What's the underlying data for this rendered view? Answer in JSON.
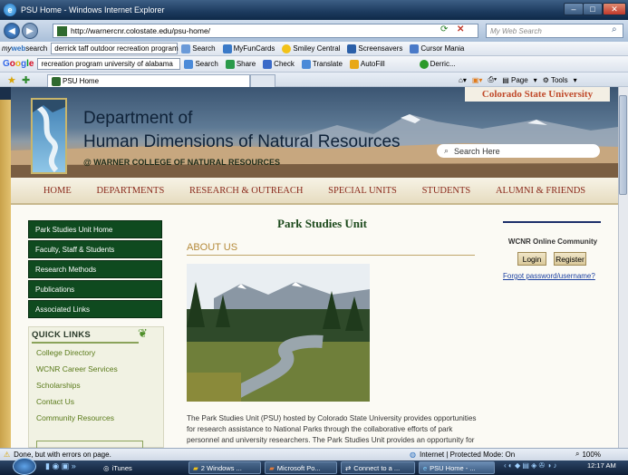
{
  "window": {
    "title": "PSU Home - Windows Internet Explorer"
  },
  "address": {
    "url": "http://warnercnr.colostate.edu/psu-home/",
    "search_placeholder": "My Web Search"
  },
  "mywebsearch": {
    "logo_a": "my",
    "logo_b": "web",
    "logo_c": "search",
    "query": "derrick taff outdoor recreation program",
    "search_label": "Search",
    "items": [
      "MyFunCards",
      "Smiley Central",
      "Screensavers",
      "Cursor Mania"
    ]
  },
  "google": {
    "query": "recreation program university of alabama",
    "search_label": "Search",
    "items": [
      "Share",
      "Check",
      "Translate",
      "AutoFill"
    ],
    "user": "Derric..."
  },
  "favorites": {
    "tab_label": "PSU Home",
    "page_label": "Page",
    "tools_label": "Tools"
  },
  "banner": {
    "csu": "Colorado State University",
    "dept_line1": "Department of",
    "dept_line2": "Human Dimensions of Natural Resources",
    "college": "@ WARNER COLLEGE OF NATURAL RESOURCES",
    "search_placeholder": "Search Here"
  },
  "nav": [
    "HOME",
    "DEPARTMENTS",
    "RESEARCH & OUTREACH",
    "SPECIAL UNITS",
    "STUDENTS",
    "ALUMNI & FRIENDS"
  ],
  "sidebar": [
    "Park Studies Unit Home",
    "Faculty, Staff & Students",
    "Research Methods",
    "Publications",
    "Associated Links"
  ],
  "quick_links": {
    "heading": "QUICK LINKS",
    "items": [
      "College Directory",
      "WCNR Career Services",
      "Scholarships",
      "Contact Us",
      "Community Resources"
    ]
  },
  "main": {
    "title": "Park Studies Unit",
    "about_heading": "ABOUT US",
    "desc_lines": [
      "The Park Studies Unit (PSU) hosted by Colorado State University provides opportunities",
      "for research assistance to National Parks through the collaborative efforts of park",
      "personnel and university researchers. The Park Studies Unit provides an opportunity for"
    ]
  },
  "right": {
    "community_label": "WCNR Online Community",
    "login": "Login",
    "register": "Register",
    "forgot": "Forgot password/username?"
  },
  "status": {
    "text": "Done, but with errors on page.",
    "zone": "Internet | Protected Mode: On",
    "zoom": "100%"
  },
  "taskbar": {
    "tasks": [
      "iTunes",
      "2 Windows ...",
      "Microsoft Po...",
      "Connect to a ...",
      "PSU Home - ..."
    ],
    "clock": "12:17 AM"
  }
}
